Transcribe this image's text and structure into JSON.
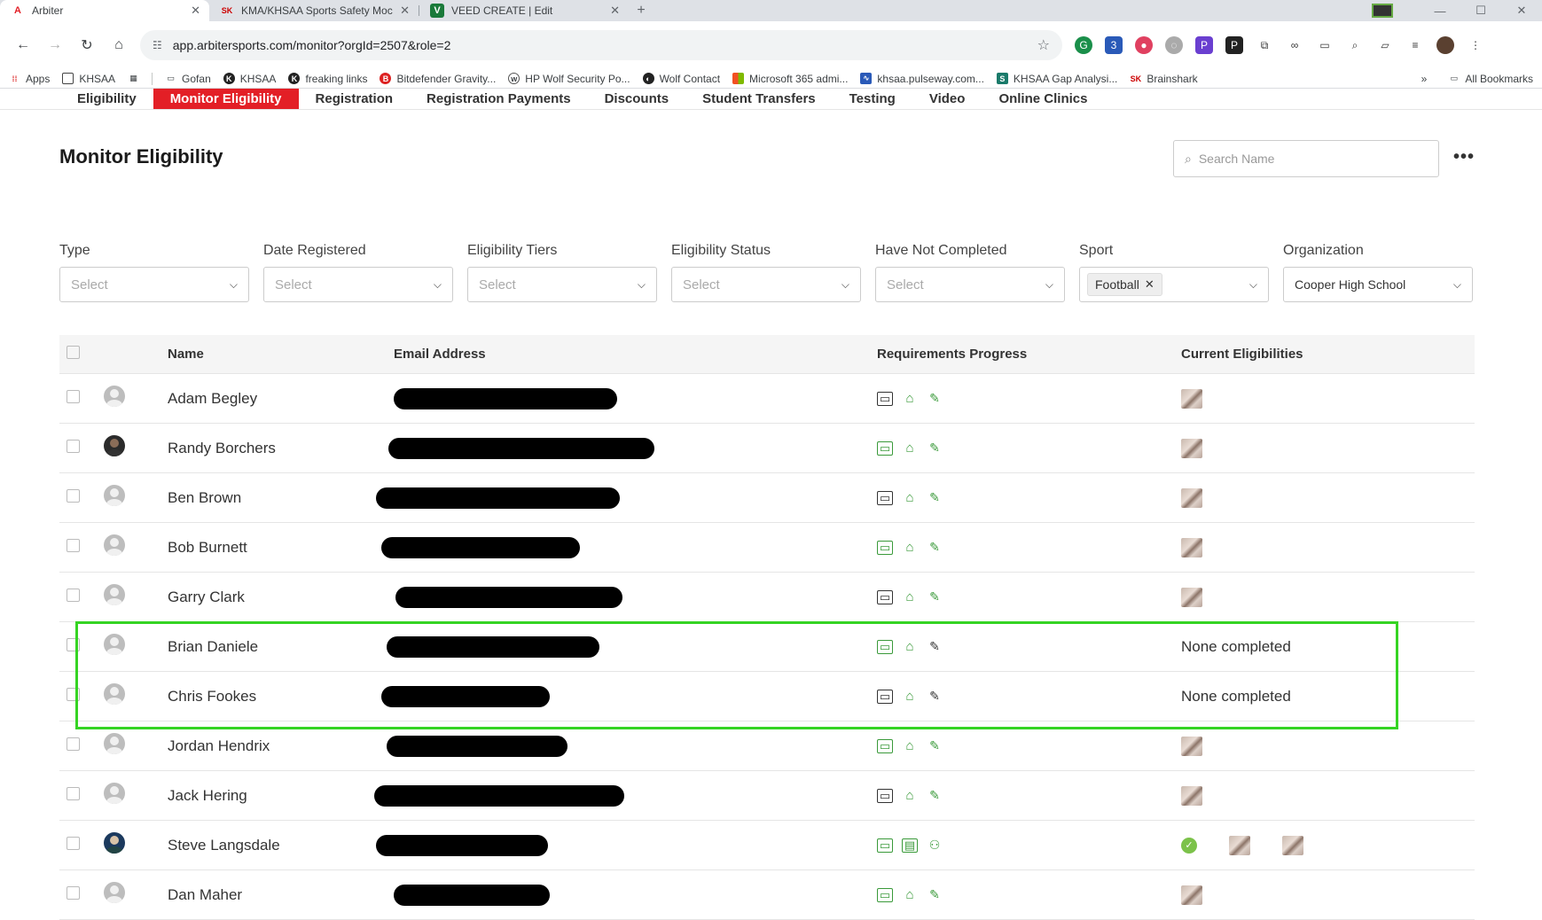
{
  "browser": {
    "tabs": [
      {
        "title": "Arbiter",
        "favicon": "A",
        "active": true
      },
      {
        "title": "KMA/KHSAA Sports Safety Moc",
        "favicon": "SK",
        "active": false
      },
      {
        "title": "VEED CREATE | Edit",
        "favicon": "V",
        "active": false
      }
    ],
    "url": "app.arbitersports.com/monitor?orgId=2507&role=2",
    "bookmarks": [
      "Apps",
      "KHSAA",
      "Gofan",
      "KHSAA",
      "freaking links",
      "Bitdefender Gravity...",
      "HP Wolf Security Po...",
      "Wolf Contact",
      "Microsoft 365 admi...",
      "khsaa.pulseway.com...",
      "KHSAA Gap Analysi...",
      "Brainshark"
    ],
    "bookmarks_more": "»",
    "all_bookmarks": "All Bookmarks"
  },
  "nav": {
    "items": [
      "Eligibility",
      "Monitor Eligibility",
      "Registration",
      "Registration Payments",
      "Discounts",
      "Student Transfers",
      "Testing",
      "Video",
      "Online Clinics"
    ],
    "active": "Monitor Eligibility"
  },
  "page": {
    "title": "Monitor Eligibility",
    "search_placeholder": "Search Name"
  },
  "filters": [
    {
      "label": "Type",
      "value": "Select",
      "filled": false
    },
    {
      "label": "Date Registered",
      "value": "Select",
      "filled": false
    },
    {
      "label": "Eligibility Tiers",
      "value": "Select",
      "filled": false
    },
    {
      "label": "Eligibility Status",
      "value": "Select",
      "filled": false
    },
    {
      "label": "Have Not Completed",
      "value": "Select",
      "filled": false
    },
    {
      "label": "Sport",
      "value": "Football",
      "filled": true,
      "chip": true
    },
    {
      "label": "Organization",
      "value": "Cooper High School",
      "filled": true
    }
  ],
  "table": {
    "headers": {
      "name": "Name",
      "email": "Email Address",
      "progress": "Requirements Progress",
      "eligibilities": "Current Eligibilities"
    },
    "none_text": "None completed",
    "rows": [
      {
        "name": "Adam Begley",
        "avatar": "default",
        "req": [
          "black",
          "green",
          "green"
        ],
        "elig": [
          "badge"
        ]
      },
      {
        "name": "Randy Borchers",
        "avatar": "photo",
        "req": [
          "green",
          "green",
          "green"
        ],
        "elig": [
          "badge"
        ]
      },
      {
        "name": "Ben Brown",
        "avatar": "default",
        "req": [
          "black",
          "green",
          "green"
        ],
        "elig": [
          "badge"
        ]
      },
      {
        "name": "Bob Burnett",
        "avatar": "default",
        "req": [
          "green",
          "green",
          "green"
        ],
        "elig": [
          "badge"
        ]
      },
      {
        "name": "Garry Clark",
        "avatar": "default",
        "req": [
          "black",
          "green",
          "green"
        ],
        "elig": [
          "badge"
        ]
      },
      {
        "name": "Brian Daniele",
        "avatar": "default",
        "req": [
          "green",
          "green",
          "black"
        ],
        "elig": []
      },
      {
        "name": "Chris Fookes",
        "avatar": "default",
        "req": [
          "black",
          "green",
          "black"
        ],
        "elig": []
      },
      {
        "name": "Jordan Hendrix",
        "avatar": "default",
        "req": [
          "green",
          "green",
          "green"
        ],
        "elig": [
          "badge"
        ]
      },
      {
        "name": "Jack Hering",
        "avatar": "default",
        "req": [
          "black",
          "green",
          "green"
        ],
        "elig": [
          "badge"
        ]
      },
      {
        "name": "Steve Langsdale",
        "avatar": "photo2",
        "req": [
          "green",
          "green",
          "green"
        ],
        "elig": [
          "check",
          "badge",
          "badge"
        ]
      },
      {
        "name": "Dan Maher",
        "avatar": "default",
        "req": [
          "green",
          "green",
          "green"
        ],
        "elig": [
          "badge"
        ]
      }
    ]
  },
  "colors": {
    "accent": "#e31f26",
    "highlight": "#35d423",
    "success": "#3a9a3a"
  }
}
